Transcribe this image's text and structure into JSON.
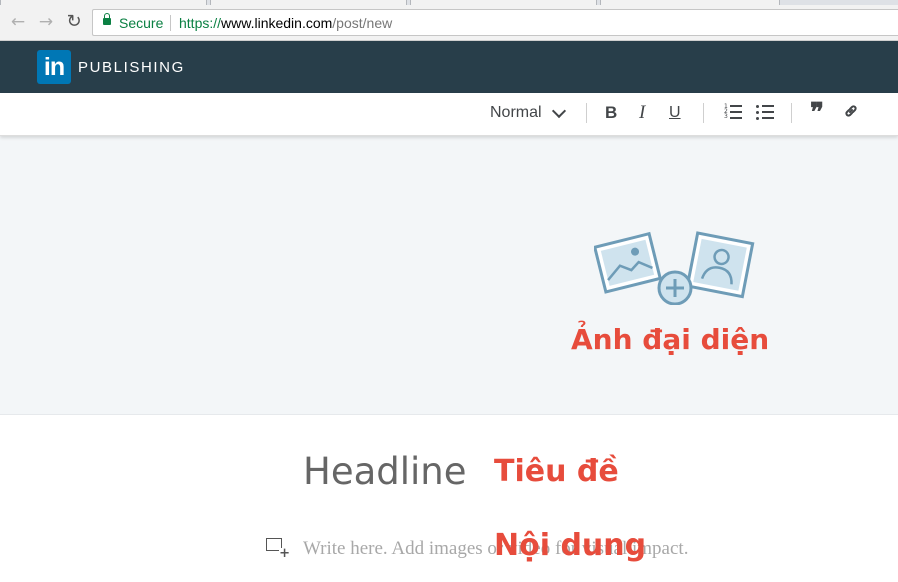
{
  "browser": {
    "security_label": "Secure",
    "url_protocol": "https://",
    "url_host": "www.linkedin.com",
    "url_path": "/post/new"
  },
  "header": {
    "logo_text": "in",
    "title": "PUBLISHING"
  },
  "toolbar": {
    "style_select": "Normal",
    "bold_label": "B",
    "italic_label": "I",
    "underline_label": "U",
    "quote_label": "❞"
  },
  "image_area": {
    "icon": "add-image-icon",
    "annotation": "Ảnh đại diện"
  },
  "editor": {
    "headline_placeholder": "Headline",
    "headline_annotation": "Tiêu đề",
    "body_placeholder": "Write here. Add images or video for visual impact.",
    "body_annotation": "Nội dung"
  },
  "colors": {
    "header_bg": "#283e4a",
    "logo_bg": "#0077b5",
    "annotation": "#e74c3c",
    "image_area_bg": "#f3f6f8",
    "secure_green": "#0b8043"
  }
}
